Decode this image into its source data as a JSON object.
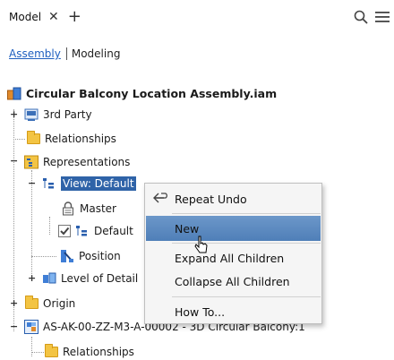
{
  "tabbar": {
    "tab_label": "Model",
    "close_icon": "close-icon",
    "add_icon": "plus-icon",
    "search_icon": "search-icon",
    "menu_icon": "hamburger-menu-icon"
  },
  "subtabs": {
    "active": "Assembly",
    "other": "Modeling"
  },
  "tree": {
    "root": "Circular Balcony Location Assembly.iam",
    "third_party": "3rd Party",
    "relationships": "Relationships",
    "representations": "Representations",
    "view": "View: Default",
    "master": "Master",
    "default_child": "Default",
    "position": "Position",
    "level_of_detail": "Level of Detail",
    "origin": "Origin",
    "subassembly": "AS-AK-00-ZZ-M3-A-00002 - 3D Circular Balcony:1",
    "relationships_child": "Relationships"
  },
  "context_menu": {
    "items": [
      "Repeat Undo",
      "New",
      "Expand All Children",
      "Collapse All Children",
      "How To..."
    ],
    "highlighted": "New"
  },
  "colors": {
    "selection": "#2f63a8",
    "menu_highlight": "#5b88bf",
    "link": "#1f5fbf"
  }
}
